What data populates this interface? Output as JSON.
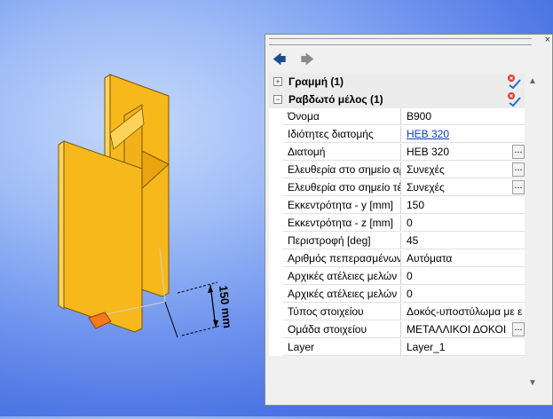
{
  "dimension": {
    "text": "150 mm"
  },
  "toolbar": {
    "back_icon": "🡄",
    "forward_icon": "🡆"
  },
  "groups": [
    {
      "title": "Γραμμή (1)",
      "expanded": false
    },
    {
      "title": "Ραβδωτό μέλος (1)",
      "expanded": true
    }
  ],
  "properties": [
    {
      "name": "Όνομα",
      "value": "B900"
    },
    {
      "name": "Ιδιότητες διατομής",
      "value": "HEB 320",
      "link": true
    },
    {
      "name": "Διατομή",
      "value": "HEB 320",
      "ellipsis": true
    },
    {
      "name": "Ελευθερία στο σημείο αρχής",
      "value": "Συνεχές",
      "ellipsis": true
    },
    {
      "name": "Ελευθερία στο σημείο τέλους",
      "value": "Συνεχές",
      "ellipsis": true
    },
    {
      "name": "Εκκεντρότητα - y [mm]",
      "value": "150"
    },
    {
      "name": "Εκκεντρότητα - z [mm]",
      "value": "0"
    },
    {
      "name": "Περιστροφή [deg]",
      "value": "45"
    },
    {
      "name": "Αριθμός πεπερασμένων στοιχείων",
      "value": "Αυτόματα"
    },
    {
      "name": "Αρχικές ατέλειες μελών y",
      "value": "0"
    },
    {
      "name": "Αρχικές ατέλειες μελών z",
      "value": "0"
    },
    {
      "name": "Τύπος στοιχείου",
      "value": "Δοκός-υποστύλωμα με ε"
    },
    {
      "name": "Ομάδα στοιχείου",
      "value": "ΜΕΤΑΛΛΙΚΟΙ ΔΟΚΟΙ",
      "ellipsis": true
    },
    {
      "name": "Layer",
      "value": "Layer_1"
    }
  ],
  "colors": {
    "steel": "#f6b81a",
    "steel_dark": "#c98a00",
    "steel_light": "#ffd35a",
    "support": "#f47a1e"
  }
}
